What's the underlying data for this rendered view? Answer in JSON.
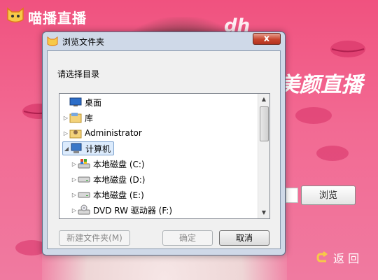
{
  "app": {
    "title": "喵播直播",
    "banner_partial": "美颜直播",
    "banner_top_partial": "dh"
  },
  "background": {
    "browse_label": "浏览",
    "back_label": "返 回"
  },
  "dialog": {
    "title": "浏览文件夹",
    "prompt": "请选择目录",
    "tree": [
      {
        "label": "桌面",
        "icon": "desktop-icon"
      },
      {
        "label": "库",
        "icon": "library-icon"
      },
      {
        "label": "Administrator",
        "icon": "user-folder-icon"
      },
      {
        "label": "计算机",
        "icon": "computer-icon",
        "selected": true
      },
      {
        "label": "本地磁盘 (C:)",
        "icon": "system-drive-icon"
      },
      {
        "label": "本地磁盘 (D:)",
        "icon": "drive-icon"
      },
      {
        "label": "本地磁盘 (E:)",
        "icon": "drive-icon"
      },
      {
        "label": "DVD RW 驱动器 (F:)",
        "icon": "dvd-drive-icon"
      }
    ],
    "buttons": {
      "new_folder": "新建文件夹(M)",
      "ok": "确定",
      "cancel": "取消"
    },
    "close_label": "x"
  },
  "colors": {
    "background": "#f0527f",
    "dialog_frame": "#cfd9e8",
    "selection": "#dcebfc",
    "close": "#c8452e"
  }
}
